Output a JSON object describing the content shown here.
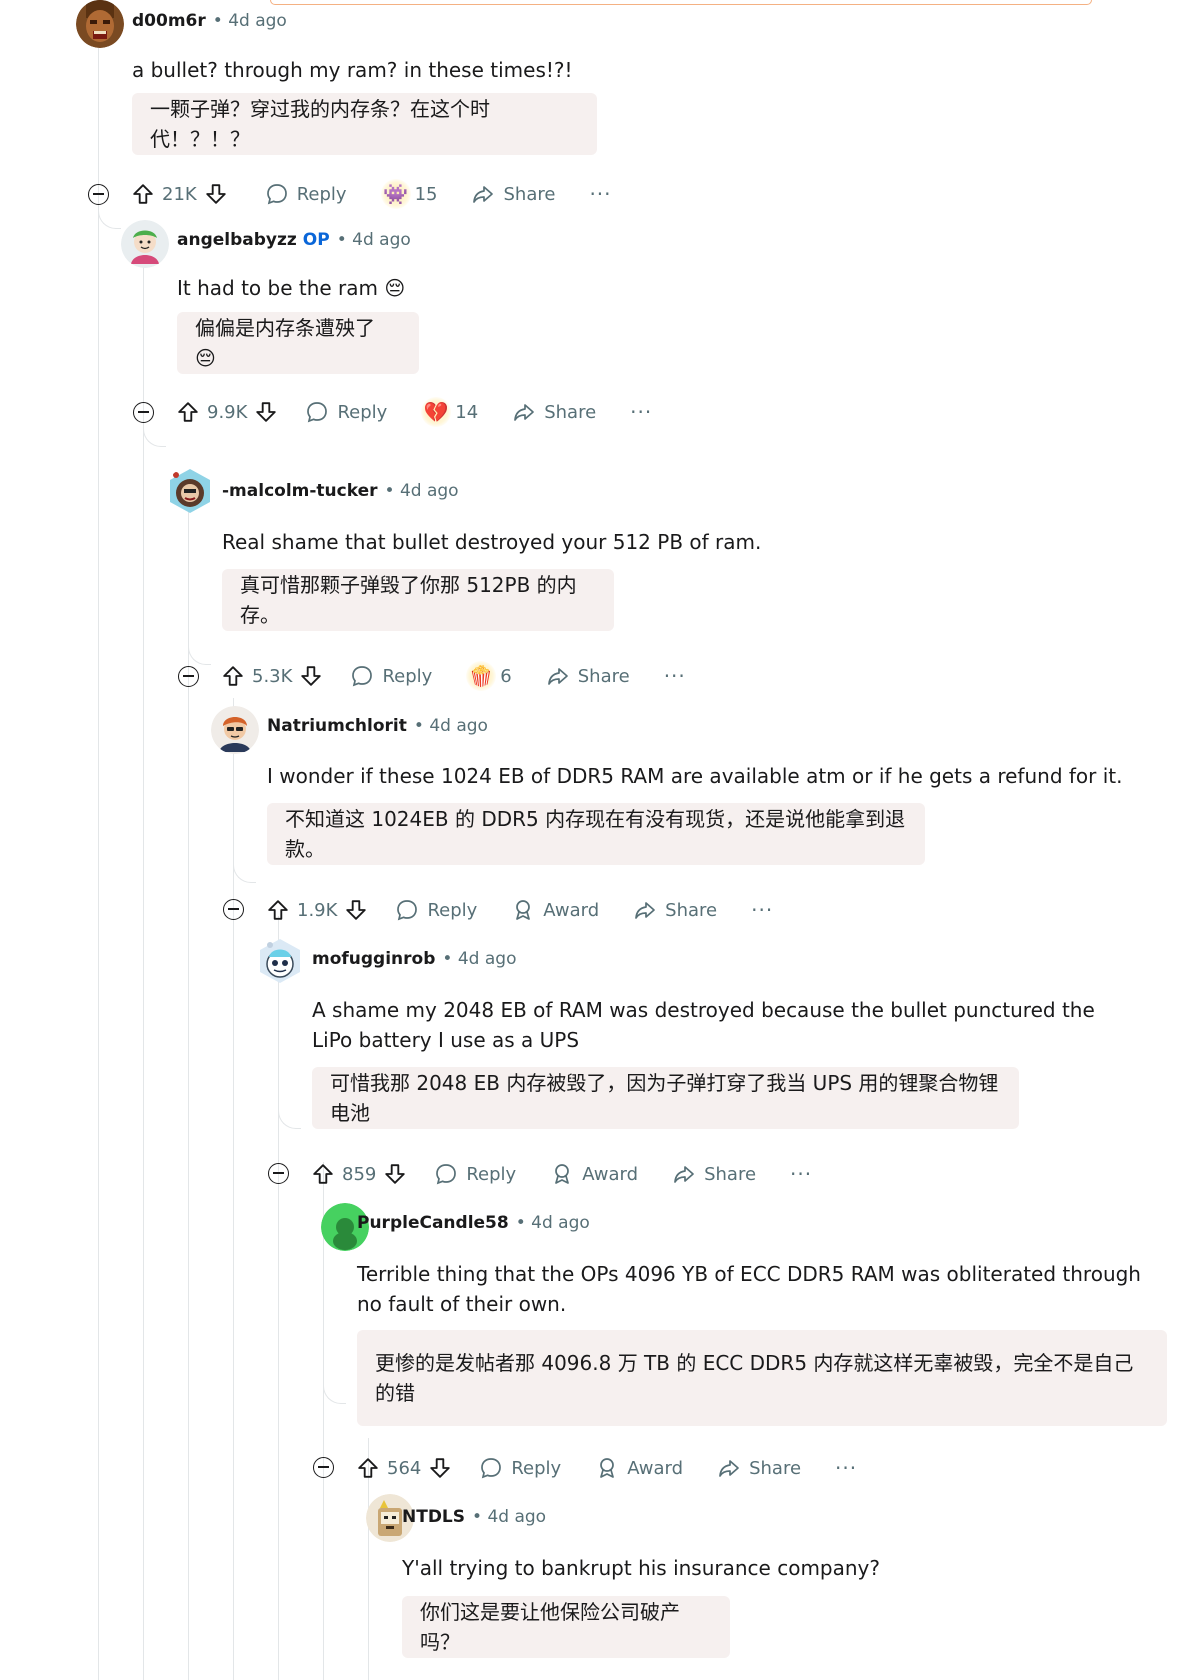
{
  "comments": [
    {
      "author": "d00m6r",
      "op": "",
      "time": "4d ago",
      "text": "a bullet? through my ram? in these times!?!",
      "translation": "一颗子弹？穿过我的内存条？在这个时代！？！？",
      "score": "21K",
      "reply": "Reply",
      "award_icon": "alien-monster-emoji",
      "award_glyph": "👾",
      "award_count": "15",
      "share": "Share",
      "more": "···",
      "avatar_color": "#8a5a2e"
    },
    {
      "author": "angelbabyzz",
      "op": "OP",
      "time": "4d ago",
      "text": "It had to be the ram 😔",
      "translation": "偏偏是内存条遭殃了 😔",
      "score": "9.9K",
      "reply": "Reply",
      "award_icon": "broken-heart-emoji",
      "award_glyph": "💔",
      "award_count": "14",
      "share": "Share",
      "more": "···",
      "avatar_color": "#e9eef0"
    },
    {
      "author": "-malcolm-tucker",
      "op": "",
      "time": "4d ago",
      "text": "Real shame that bullet destroyed your 512 PB of ram.",
      "translation": "真可惜那颗子弹毁了你那 512PB 的内存。",
      "score": "5.3K",
      "reply": "Reply",
      "award_icon": "popcorn-emoji",
      "award_glyph": "🍿",
      "award_count": "6",
      "share": "Share",
      "more": "···",
      "avatar_color": "#5a3a2a"
    },
    {
      "author": "Natriumchlorit",
      "op": "",
      "time": "4d ago",
      "text": "I wonder if these 1024 EB of DDR5 RAM are available atm or if he gets a refund for it.",
      "translation": "不知道这 1024EB 的 DDR5 内存现在有没有现货，还是说他能拿到退款。",
      "score": "1.9K",
      "reply": "Reply",
      "award": "Award",
      "share": "Share",
      "more": "···",
      "avatar_color": "#f0ece8"
    },
    {
      "author": "mofugginrob",
      "op": "",
      "time": "4d ago",
      "text": "A shame my 2048 EB of RAM was destroyed because the bullet punctured the LiPo battery I use as a UPS",
      "translation": "可惜我那 2048 EB 内存被毁了，因为子弹打穿了我当 UPS 用的锂聚合物锂电池",
      "score": "859",
      "reply": "Reply",
      "award": "Award",
      "share": "Share",
      "more": "···",
      "avatar_color": "#e8f0f6"
    },
    {
      "author": "PurpleCandle58",
      "op": "",
      "time": "4d ago",
      "text": "Terrible thing that the OPs 4096 YB of ECC DDR5 RAM was obliterated through no fault of their own.",
      "translation": "更惨的是发帖者那 4096.8 万 TB 的 ECC DDR5 内存就这样无辜被毁，完全不是自己的错",
      "score": "564",
      "reply": "Reply",
      "award": "Award",
      "share": "Share",
      "more": "···",
      "avatar_color": "#46d160"
    },
    {
      "author": "NTDLS",
      "op": "",
      "time": "4d ago",
      "text": "Y'all trying to bankrupt his insurance company?",
      "translation": "你们这是要让他保险公司破产吗？",
      "avatar_color": "#efe6d6"
    }
  ]
}
